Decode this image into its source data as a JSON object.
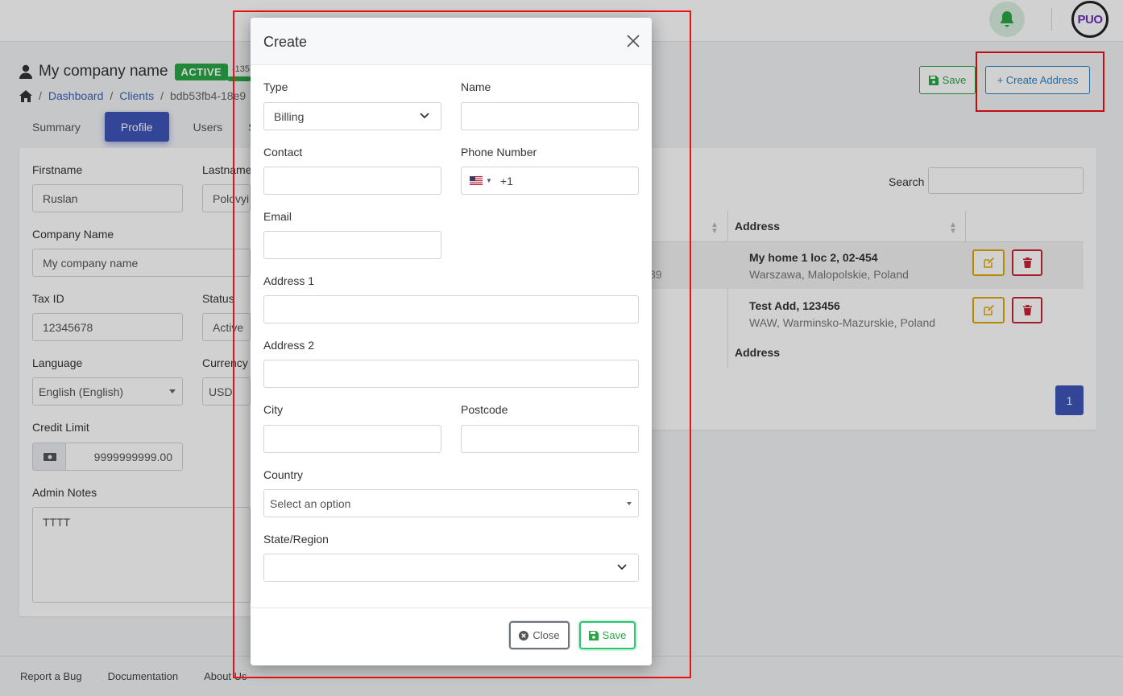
{
  "header": {
    "company_title": "My company name",
    "status_badge": "ACTIVE",
    "small_number": "-135",
    "breadcrumb": [
      "Dashboard",
      "Clients",
      "bdb53fb4-18e9"
    ],
    "save_label": "Save",
    "create_address_label": "+ Create Address"
  },
  "tabs": [
    "Summary",
    "Profile",
    "Users",
    "S"
  ],
  "profile_form": {
    "firstname_label": "Firstname",
    "firstname_value": "Ruslan",
    "lastname_label": "Lastname",
    "lastname_value": "Polovyi",
    "company_label": "Company Name",
    "company_value": "My company name",
    "taxid_label": "Tax ID",
    "taxid_value": "12345678",
    "status_label": "Status",
    "status_value": "Active",
    "language_label": "Language",
    "language_value": "English (English)",
    "currency_label": "Currency",
    "currency_value": "USD",
    "credit_label": "Credit Limit",
    "credit_value": "9999999999.00",
    "notes_label": "Admin Notes",
    "notes_value": "TTTT"
  },
  "addresses_table": {
    "search_label": "Search",
    "column_header": "Address",
    "cut_value": "39",
    "rows": [
      {
        "main": "My home 1 loc 2, 02-454",
        "sub": "Warszawa, Malopolskie, Poland"
      },
      {
        "main": "Test Add, 123456",
        "sub": "WAW, Warminsko-Mazurskie, Poland"
      }
    ],
    "footer_header": "Address",
    "page": "1"
  },
  "footer": [
    "Report a Bug",
    "Documentation",
    "About Us"
  ],
  "logo_text": "PUO",
  "modal": {
    "title": "Create",
    "type_label": "Type",
    "type_value": "Billing",
    "name_label": "Name",
    "contact_label": "Contact",
    "phone_label": "Phone Number",
    "phone_code": "+1",
    "email_label": "Email",
    "address1_label": "Address 1",
    "address2_label": "Address 2",
    "city_label": "City",
    "postcode_label": "Postcode",
    "country_label": "Country",
    "country_placeholder": "Select an option",
    "state_label": "State/Region",
    "close_label": "Close",
    "save_label": "Save"
  },
  "colors": {
    "primary": "#3d55b8",
    "success": "#28a745",
    "warning": "#e0a800",
    "danger": "#c82333",
    "highlight_frame": "#ee1111"
  },
  "icons": [
    "bell-icon",
    "user-icon",
    "home-icon",
    "floppy-icon",
    "plus-icon",
    "money-icon",
    "edit-icon",
    "trash-icon",
    "close-icon",
    "chevron-down-icon",
    "us-flag-icon",
    "x-circle-icon"
  ]
}
